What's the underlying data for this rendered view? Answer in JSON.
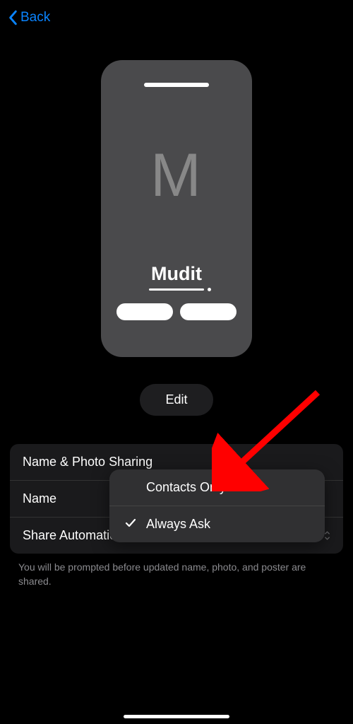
{
  "header": {
    "back_label": "Back"
  },
  "poster": {
    "monogram": "M",
    "name": "Mudit"
  },
  "edit_label": "Edit",
  "settings": {
    "row1_label": "Name & Photo Sharing",
    "row2_label": "Name",
    "row3_label": "Share Automatically",
    "row3_value": "Always Ask"
  },
  "popup": {
    "option1": "Contacts Only",
    "option2": "Always Ask"
  },
  "footer": "You will be prompted before updated name, photo, and poster are shared."
}
